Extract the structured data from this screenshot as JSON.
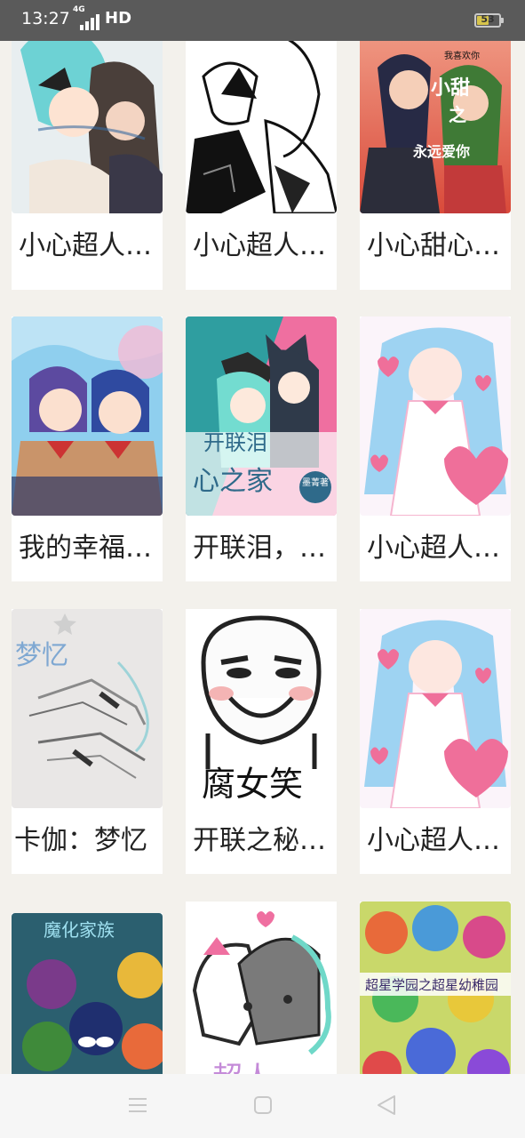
{
  "status_bar": {
    "time": "13:27",
    "network": "4G",
    "hd": "HD",
    "battery": "53",
    "battery_level_percent": 53
  },
  "books": [
    {
      "title": "小心超人…",
      "cover_colors": [
        "#dfeff0",
        "#5fc9c9",
        "#3a3a3a"
      ]
    },
    {
      "title": "小心超人…",
      "cover_colors": [
        "#ffffff",
        "#111111",
        "#8a8a8a"
      ]
    },
    {
      "title": "小心甜心…",
      "cover_colors": [
        "#e8735e",
        "#2a2d4a",
        "#4a8a3a"
      ],
      "cover_text": [
        "我喜欢你",
        "小甜",
        "之",
        "永远爱你"
      ]
    },
    {
      "title": "我的幸福…",
      "cover_colors": [
        "#8fd1ee",
        "#5e4aa0",
        "#c98a5a"
      ]
    },
    {
      "title": "开联泪，…",
      "cover_colors": [
        "#ef6fa0",
        "#6fd8c8",
        "#2f3a4a"
      ],
      "cover_text": [
        "开联泪",
        "心之家",
        "墨菁著"
      ]
    },
    {
      "title": "小心超人…",
      "cover_colors": [
        "#fbf4fa",
        "#9ed3f2",
        "#ef6f9a"
      ]
    },
    {
      "title": "卡伽：梦忆",
      "cover_colors": [
        "#e9e7e6",
        "#88b0d6",
        "#8f8f8f"
      ],
      "cover_text": [
        "梦忆"
      ]
    },
    {
      "title": "开联之秘…",
      "cover_colors": [
        "#ffffff",
        "#222222",
        "#f2a3a3"
      ],
      "cover_text": [
        "腐女笑"
      ]
    },
    {
      "title": "小心超人…",
      "cover_colors": [
        "#fbf4fa",
        "#9ed3f2",
        "#ef6f9a"
      ]
    },
    {
      "title": "",
      "cover_colors": [
        "#2b5f6f",
        "#7a3a8a",
        "#e86a3a"
      ],
      "cover_text": [
        "魔化家族"
      ]
    },
    {
      "title": "",
      "cover_colors": [
        "#ffffff",
        "#6fd8c8",
        "#2f2f2f"
      ],
      "cover_text": [
        "超人"
      ]
    },
    {
      "title": "",
      "cover_colors": [
        "#b8d84a",
        "#e04a4a",
        "#4a6ad8"
      ],
      "cover_text": [
        "超星学园之超星幼稚园"
      ]
    }
  ],
  "nav_bar": {
    "menu": "menu-icon",
    "home": "home-icon",
    "back": "back-icon"
  }
}
